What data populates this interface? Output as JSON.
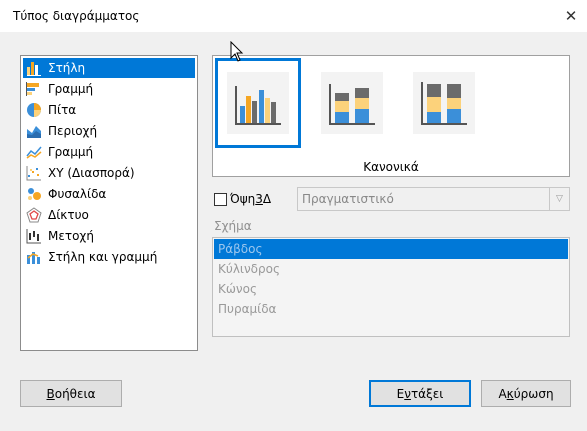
{
  "window": {
    "title": "Τύπος διαγράμματος",
    "close_glyph": "✕"
  },
  "chart_types": [
    {
      "label": "Στήλη",
      "icon": "bar-chart-icon",
      "selected": true
    },
    {
      "label": "Γραμμή",
      "icon": "horizontal-bar-chart-icon",
      "selected": false
    },
    {
      "label": "Πίτα",
      "icon": "pie-chart-icon",
      "selected": false
    },
    {
      "label": "Περιοχή",
      "icon": "area-chart-icon",
      "selected": false
    },
    {
      "label": "Γραμμή",
      "icon": "line-chart-icon",
      "selected": false
    },
    {
      "label": "XY (Διασπορά)",
      "icon": "scatter-chart-icon",
      "selected": false
    },
    {
      "label": "Φυσαλίδα",
      "icon": "bubble-chart-icon",
      "selected": false
    },
    {
      "label": "Δίκτυο",
      "icon": "net-chart-icon",
      "selected": false
    },
    {
      "label": "Μετοχή",
      "icon": "stock-chart-icon",
      "selected": false
    },
    {
      "label": "Στήλη και γραμμή",
      "icon": "column-line-chart-icon",
      "selected": false
    }
  ],
  "variants": {
    "items": [
      {
        "name": "normal",
        "icon": "normal-columns-icon",
        "selected": true
      },
      {
        "name": "stacked",
        "icon": "stacked-columns-icon",
        "selected": false
      },
      {
        "name": "percent-stacked",
        "icon": "percent-stacked-columns-icon",
        "selected": false
      }
    ],
    "selected_label": "Κανονικά"
  },
  "view3d": {
    "checkbox_label_pre": "Όψη ",
    "checkbox_label_accel": "3",
    "checkbox_label_post": "Δ",
    "checked": false,
    "scheme_value": "Πραγματιστικό"
  },
  "shape": {
    "label": "Σχήμα",
    "items": [
      "Ράβδος",
      "Κύλινδρος",
      "Κώνος",
      "Πυραμίδα"
    ],
    "selected_index": 0
  },
  "buttons": {
    "help": {
      "accel": "Β",
      "rest": "οήθεια"
    },
    "ok": {
      "pre": "Ε",
      "accel": "ν",
      "post": "τάξει"
    },
    "cancel": {
      "pre": "Α",
      "accel": "κ",
      "post": "ύρωση"
    }
  },
  "colors": {
    "selection": "#0078d7",
    "bar_orange": "#f5a623",
    "bar_blue": "#3b8fd9",
    "bar_yellow": "#fcd27b",
    "bar_gray": "#6b6b6b"
  }
}
